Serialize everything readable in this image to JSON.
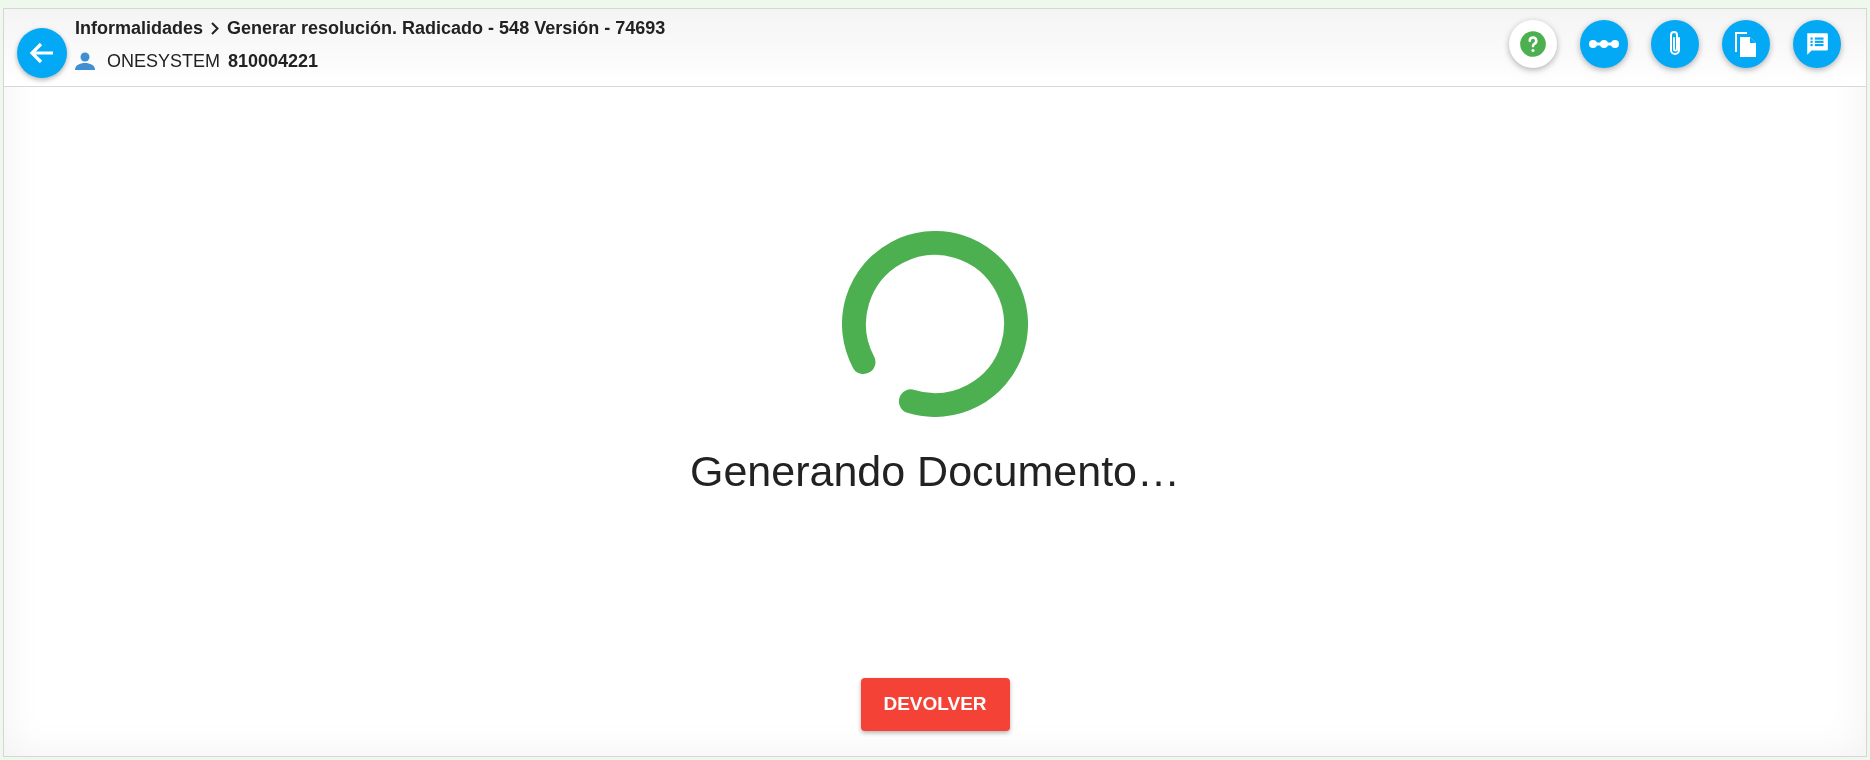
{
  "header": {
    "breadcrumb": [
      "Informalidades",
      "Generar resolución. Radicado - 548 Versión - 74693"
    ],
    "user": {
      "name": "ONESYSTEM",
      "id": "810004221"
    },
    "actions": [
      {
        "kind": "help"
      },
      {
        "kind": "flow"
      },
      {
        "kind": "attach"
      },
      {
        "kind": "copy"
      },
      {
        "kind": "comments"
      }
    ]
  },
  "status": {
    "message": "Generando Documento…"
  },
  "buttons": [
    {
      "label": "DEVOLVER"
    }
  ]
}
